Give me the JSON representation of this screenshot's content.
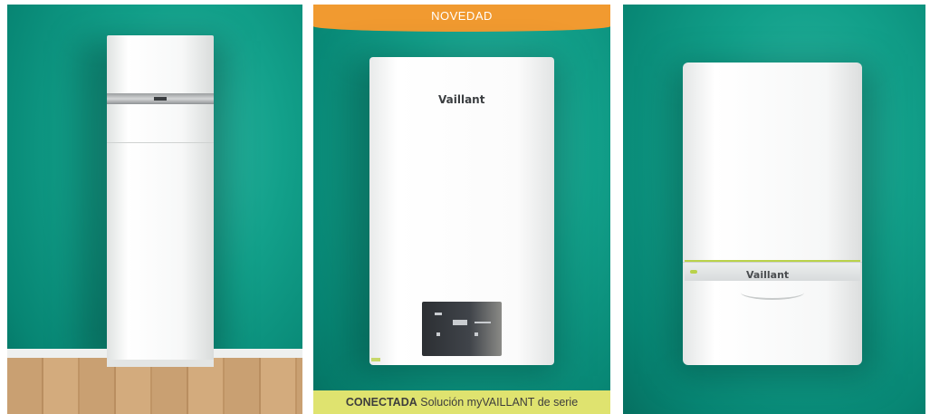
{
  "panels": [
    {
      "id": "floor-standing-unit"
    },
    {
      "id": "wall-boiler",
      "badge": "NOVEDAD",
      "footer_bold": "CONECTADA",
      "footer_text": " Solución myVAILLANT de serie",
      "brand": "Vaillant"
    },
    {
      "id": "green-accent-boiler",
      "brand": "Vaillant"
    }
  ],
  "colors": {
    "wall": "#12a08a",
    "badge": "#f19a30",
    "footer": "#dfe36f",
    "accent": "#b9d24a"
  }
}
